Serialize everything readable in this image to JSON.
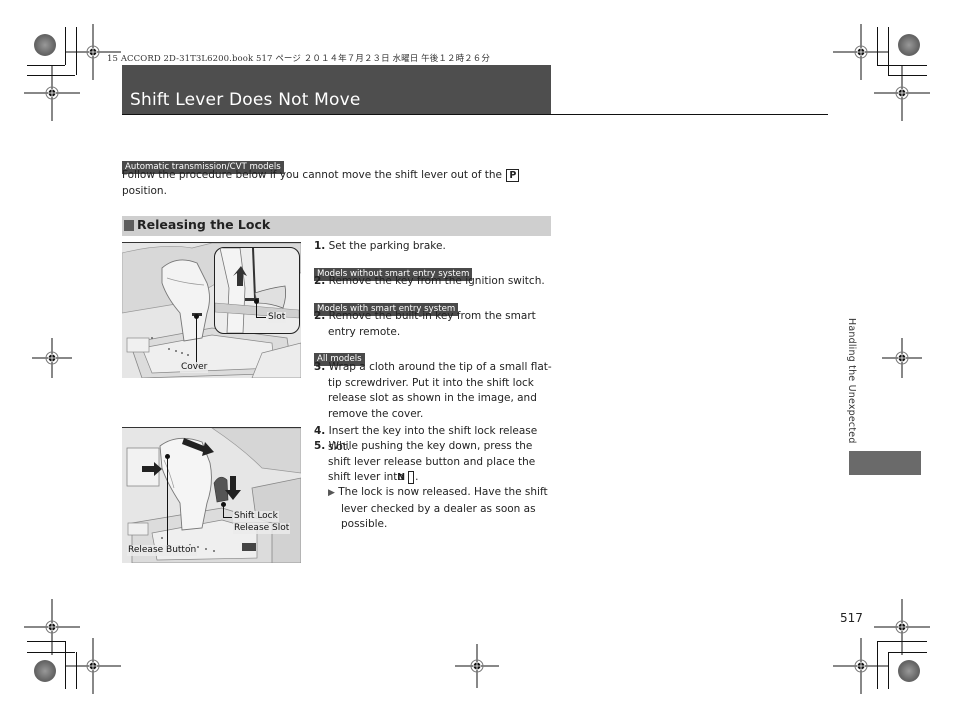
{
  "print_header": "15 ACCORD 2D-31T3L6200.book  517 ページ  ２０１４年７月２３日  水曜日  午後１２時２６分",
  "page": {
    "title": "Shift Lever Does Not Move",
    "number": "517",
    "sidebar_chapter": "Handling the Unexpected"
  },
  "intro": {
    "tag": "Automatic transmission/CVT models",
    "text_before": "Follow the procedure below if you cannot move the shift lever out of the",
    "key": "P",
    "text_after": "position."
  },
  "section": {
    "heading": "Releasing the Lock"
  },
  "figures": [
    {
      "name": "cover-slot-illustration",
      "labels": [
        "Slot",
        "Cover"
      ]
    },
    {
      "name": "release-button-illustration",
      "labels": [
        "Shift Lock\nRelease Slot",
        "Release Button"
      ],
      "label_shift_lock": "Shift Lock",
      "label_release_slot": "Release Slot",
      "label_release_button": "Release Button"
    }
  ],
  "steps": [
    {
      "number": "1.",
      "text": "Set the parking brake."
    },
    {
      "tag": "Models without smart entry system",
      "number": "2.",
      "text": "Remove the key from the ignition switch."
    },
    {
      "tag": "Models with smart entry system",
      "number": "2.",
      "text": "Remove the built-in key from the smart entry remote."
    },
    {
      "tag": "All models",
      "number": "3.",
      "text": "Wrap a cloth around the tip of a small flat-tip screwdriver. Put it into the shift lock release slot as shown in the image, and remove the cover."
    },
    {
      "number": "4.",
      "text": "Insert the key into the shift lock release slot."
    },
    {
      "number": "5.",
      "text_before": "While pushing the key down, press the shift lever release button and place the shift lever into",
      "key": "N",
      "text_after": "."
    }
  ],
  "result_note": "The lock is now released. Have the shift lever checked by a dealer as soon as possible."
}
